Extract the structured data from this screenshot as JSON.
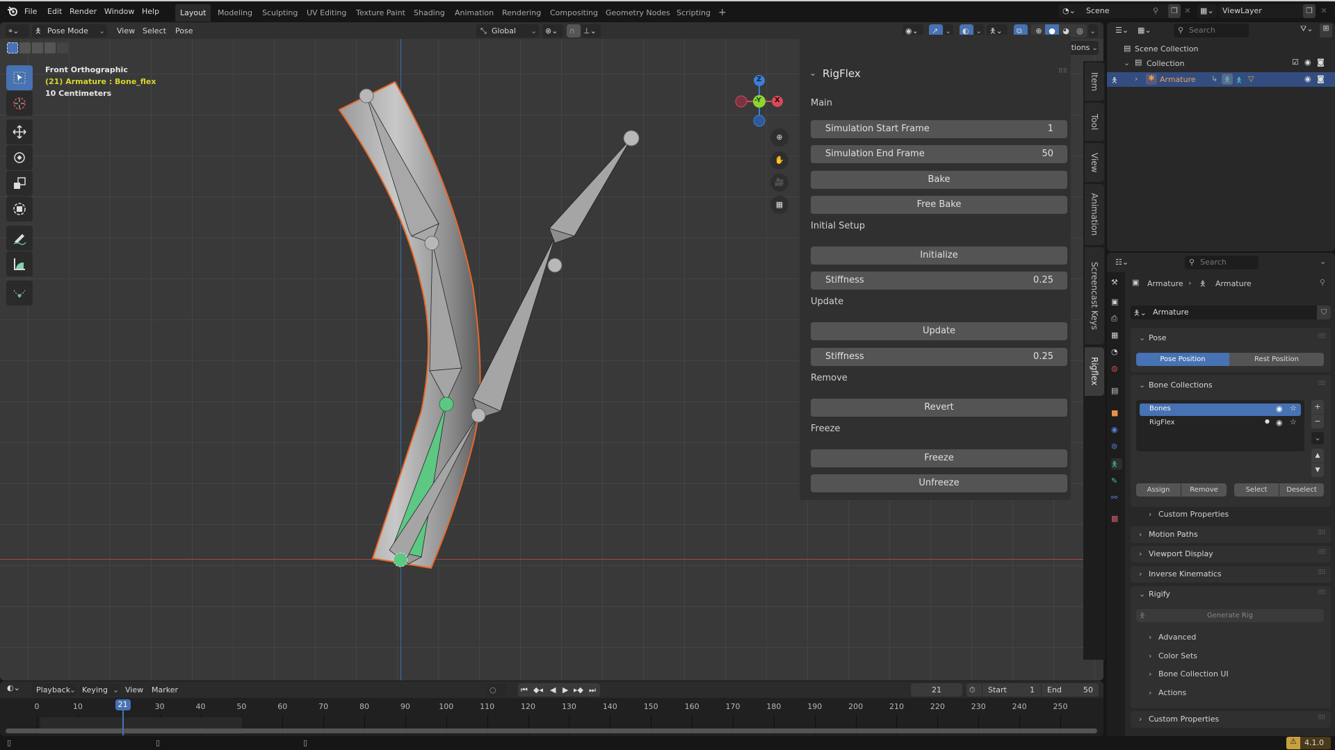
{
  "topbar": {
    "menus": [
      "File",
      "Edit",
      "Render",
      "Window",
      "Help"
    ],
    "workspaces": [
      "Layout",
      "Modeling",
      "Sculpting",
      "UV Editing",
      "Texture Paint",
      "Shading",
      "Animation",
      "Rendering",
      "Compositing",
      "Geometry Nodes",
      "Scripting"
    ],
    "active_workspace": "Layout",
    "add_workspace": "+",
    "scene": "Scene",
    "view_layer": "ViewLayer"
  },
  "viewport": {
    "mode": "Pose Mode",
    "menus": [
      "View",
      "Select",
      "Pose"
    ],
    "orientation": "Global",
    "pose_options": "Pose Options",
    "mirror_x": "X",
    "overlay": {
      "view_name": "Front Orthographic",
      "object_info": "(21) Armature : Bone_flex",
      "scale": "10 Centimeters"
    },
    "gizmo": {
      "z": "Z",
      "y": "-Y",
      "x": "X"
    },
    "colors": {
      "selected_outline": "#e8692a",
      "active_bone": "#5dc882",
      "info_yellow": "#d6d62c"
    }
  },
  "rigflex_panel": {
    "title": "RigFlex",
    "sections": {
      "main": "Main",
      "initial_setup": "Initial Setup",
      "update": "Update",
      "remove": "Remove",
      "freeze": "Freeze"
    },
    "sim_start": {
      "label": "Simulation Start Frame",
      "value": "1"
    },
    "sim_end": {
      "label": "Simulation End Frame",
      "value": "50"
    },
    "bake": "Bake",
    "free_bake": "Free Bake",
    "initialize": "Initialize",
    "initial_stiffness": {
      "label": "Stiffness",
      "value": "0.25"
    },
    "update_button": "Update",
    "update_stiffness": {
      "label": "Stiffness",
      "value": "0.25"
    },
    "revert": "Revert",
    "freeze_button": "Freeze",
    "unfreeze": "Unfreeze"
  },
  "sidebar_tabs": [
    "Item",
    "Tool",
    "View",
    "Animation",
    "Screencast Keys",
    "Rigflex"
  ],
  "active_sidebar_tab": "Rigflex",
  "outliner": {
    "search_placeholder": "Search",
    "scene_collection": "Scene Collection",
    "collection": "Collection",
    "armature": "Armature"
  },
  "properties": {
    "search_placeholder": "Search",
    "breadcrumb": [
      "Armature",
      "Armature"
    ],
    "data_name": "Armature",
    "pose": {
      "title": "Pose",
      "pose_position": "Pose Position",
      "rest_position": "Rest Position"
    },
    "bone_collections": {
      "title": "Bone Collections",
      "items": [
        {
          "name": "Bones",
          "active": true
        },
        {
          "name": "RigFlex",
          "active": false
        }
      ],
      "assign": "Assign",
      "remove": "Remove",
      "select": "Select",
      "deselect": "Deselect",
      "custom_properties": "Custom Properties"
    },
    "panels": [
      "Motion Paths",
      "Viewport Display",
      "Inverse Kinematics"
    ],
    "rigify": {
      "title": "Rigify",
      "generate": "Generate Rig",
      "subpanels": [
        "Advanced",
        "Color Sets",
        "Bone Collection UI",
        "Actions"
      ]
    },
    "custom_properties": "Custom Properties"
  },
  "timeline": {
    "menus": [
      "Playback",
      "Keying",
      "View",
      "Marker"
    ],
    "current_frame": "21",
    "start_label": "Start",
    "start": "1",
    "end_label": "End",
    "end": "50",
    "ticks": [
      "0",
      "10",
      "30",
      "40",
      "50",
      "60",
      "70",
      "80",
      "90",
      "100",
      "110",
      "120",
      "130",
      "140",
      "150",
      "160",
      "170",
      "180",
      "190",
      "200",
      "210",
      "220",
      "230",
      "240",
      "250"
    ],
    "playhead": "21",
    "frame_range": [
      0,
      250
    ]
  },
  "status": {
    "version": "4.1.0"
  }
}
